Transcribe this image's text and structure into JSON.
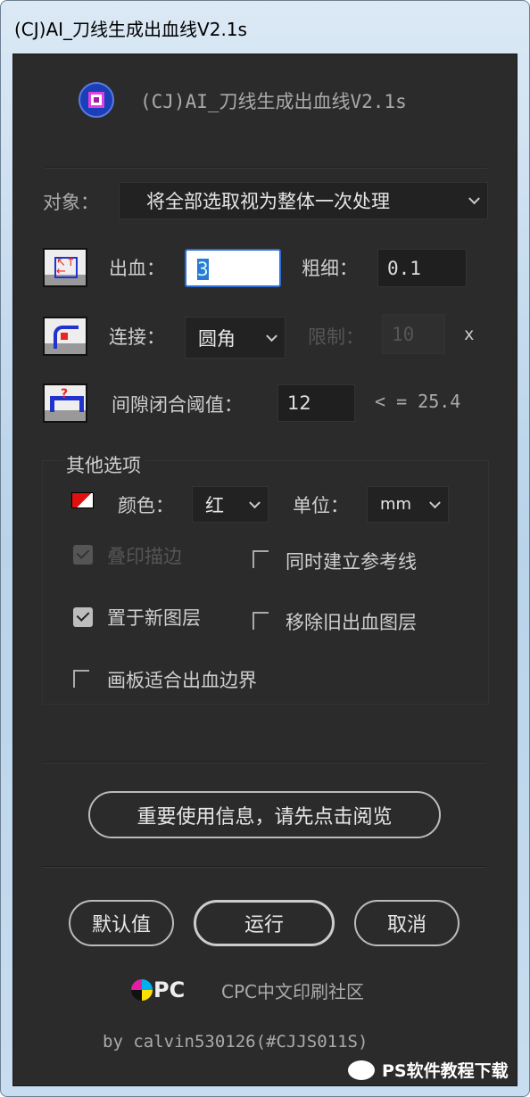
{
  "window": {
    "title": "(CJ)AI_刀线生成出血线V2.1s"
  },
  "header": {
    "title": "(CJ)AI_刀线生成出血线V2.1s",
    "logo": "concentric-square-logo"
  },
  "object": {
    "label": "对象：",
    "value": "将全部选取视为整体一次处理"
  },
  "bleed": {
    "label": "出血：",
    "value": "3",
    "weight_label": "粗细：",
    "weight_value": "0.1"
  },
  "join": {
    "label": "连接：",
    "value": "圆角",
    "limit_label": "限制：",
    "limit_value": "10",
    "limit_unit": "x"
  },
  "gap": {
    "label": "间隙闭合阈值：",
    "value": "12",
    "max": "< = 25.4"
  },
  "other": {
    "legend": "其他选项",
    "color_label": "颜色：",
    "color_value": "红",
    "color_swatch": "#e01010",
    "unit_label": "单位：",
    "unit_value": "mm",
    "options": [
      {
        "label": "叠印描边",
        "checked": true,
        "disabled": true
      },
      {
        "label": "同时建立参考线",
        "checked": false
      },
      {
        "label": "置于新图层",
        "checked": true
      },
      {
        "label": "移除旧出血图层",
        "checked": false
      },
      {
        "label": "画板适合出血边界",
        "checked": false
      }
    ]
  },
  "info_button": "重要使用信息，请先点击阅览",
  "buttons": {
    "defaults": "默认值",
    "run": "运行",
    "cancel": "取消"
  },
  "footer": {
    "logo_text": "CPC",
    "community": "CPC中文印刷社区",
    "credit": "by calvin530126(#CJJS011S)"
  },
  "watermark": "PS软件教程下载"
}
